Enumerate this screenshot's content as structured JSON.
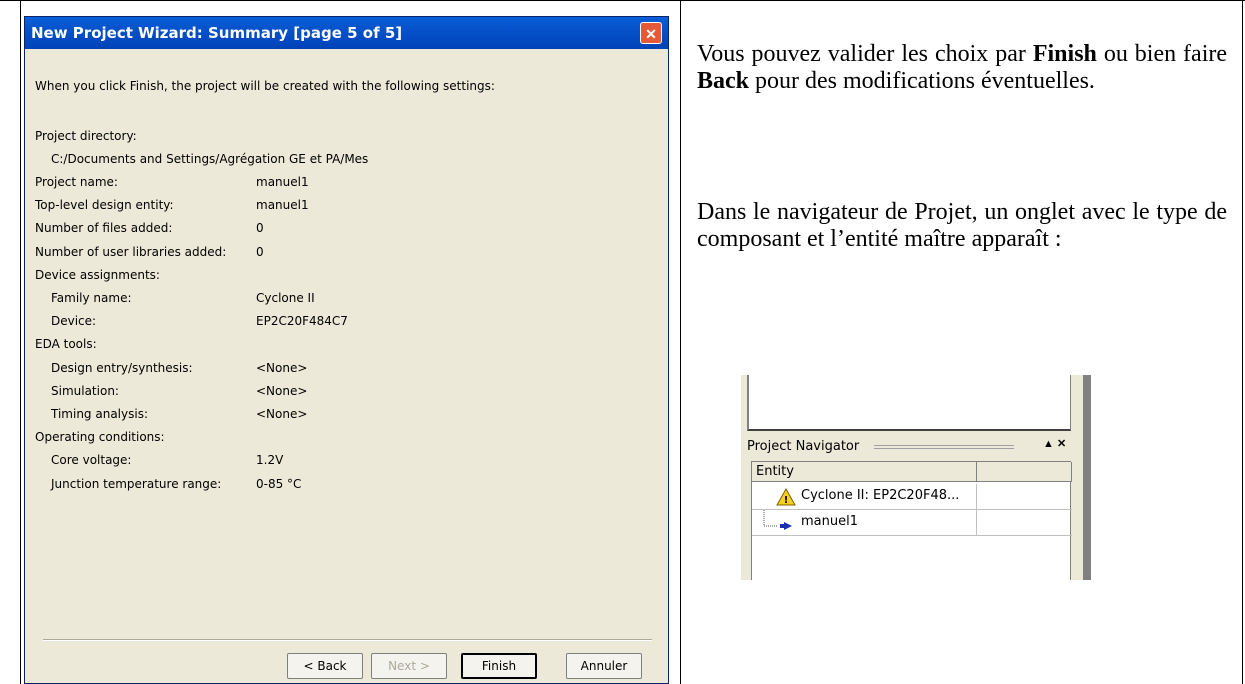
{
  "wizard": {
    "title": "New Project Wizard: Summary [page 5 of 5]",
    "close_glyph": "✕",
    "intro": "When you click Finish, the project will be created with the following settings:",
    "project_directory_label": "Project directory:",
    "project_directory_value": "C:/Documents and Settings/Agrégation GE et PA/Mes",
    "rows": [
      {
        "label": "Project name:",
        "value": "manuel1"
      },
      {
        "label": "Top-level design entity:",
        "value": "manuel1"
      },
      {
        "label": "Number of files added:",
        "value": "0"
      },
      {
        "label": "Number of user libraries added:",
        "value": "0"
      },
      {
        "label": "Device assignments:",
        "value": ""
      },
      {
        "label": "Family name:",
        "value": "Cyclone II"
      },
      {
        "label": "Device:",
        "value": "EP2C20F484C7"
      },
      {
        "label": "EDA tools:",
        "value": ""
      },
      {
        "label": "Design entry/synthesis:",
        "value": "<None>"
      },
      {
        "label": "Simulation:",
        "value": "<None>"
      },
      {
        "label": "Timing analysis:",
        "value": "<None>"
      },
      {
        "label": "Operating conditions:",
        "value": ""
      },
      {
        "label": "Core voltage:",
        "value": "1.2V"
      },
      {
        "label": "Junction temperature range:",
        "value": "0-85 °C"
      }
    ],
    "buttons": {
      "back": "< Back",
      "next": "Next >",
      "finish": "Finish",
      "cancel": "Annuler"
    }
  },
  "text": {
    "p1_a": "Vous pouvez valider les choix par ",
    "p1_finish": "Finish",
    "p1_b": " ou bien faire ",
    "p1_back": "Back",
    "p1_c": " pour des modifications éventuelles.",
    "p2": "Dans le navigateur de Projet, un onglet avec le type de composant et l’entité maître apparaît :"
  },
  "navigator": {
    "title": "Project Navigator",
    "controls": "▲ ✕",
    "column_header": "Entity",
    "device_item": "Cyclone II: EP2C20F48...",
    "entity_item": "manuel1",
    "warning_icon": "warning-triangle-icon",
    "entity_icon": "arrow-entity-icon"
  }
}
